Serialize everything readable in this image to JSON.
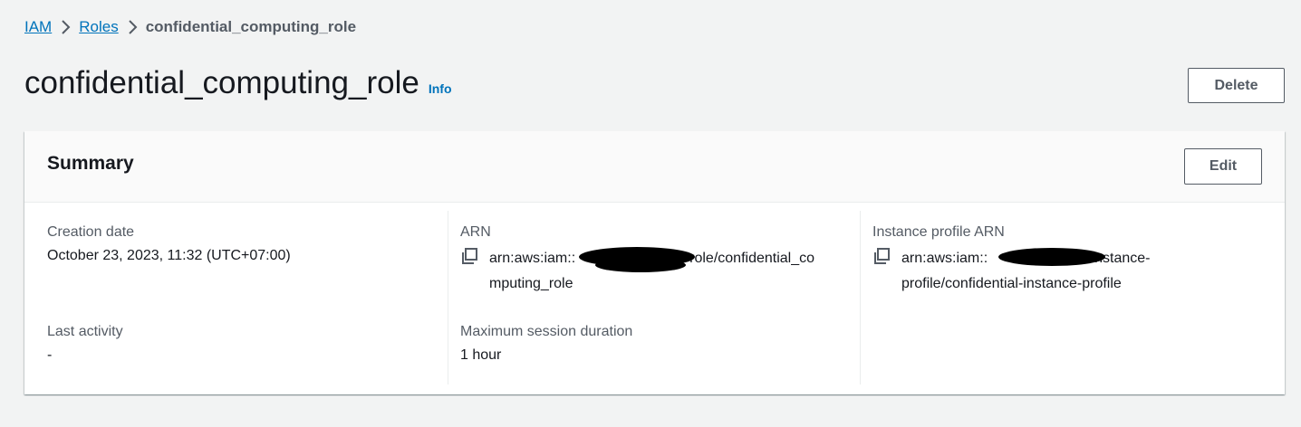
{
  "breadcrumb": {
    "items": [
      "IAM",
      "Roles"
    ],
    "current": "confidential_computing_role"
  },
  "header": {
    "title": "confidential_computing_role",
    "info_label": "Info",
    "delete_label": "Delete"
  },
  "summary": {
    "title": "Summary",
    "edit_label": "Edit",
    "creation_date": {
      "label": "Creation date",
      "value": "October 23, 2023, 11:32 (UTC+07:00)"
    },
    "last_activity": {
      "label": "Last activity",
      "value": "-"
    },
    "arn": {
      "label": "ARN",
      "value": "arn:aws:iam::",
      "value_suffix_line1": "role/confidential_co",
      "value_line2": "mputing_role"
    },
    "max_session": {
      "label": "Maximum session duration",
      "value": "1 hour"
    },
    "instance_profile_arn": {
      "label": "Instance profile ARN",
      "value_prefix": "arn:aws:iam::",
      "value_suffix_line1": ":instance-",
      "value_line2": "profile/confidential-instance-profile"
    }
  },
  "colors": {
    "link": "#0073bb",
    "text": "#16191f",
    "secondary": "#545b64",
    "background": "#f2f3f3"
  }
}
